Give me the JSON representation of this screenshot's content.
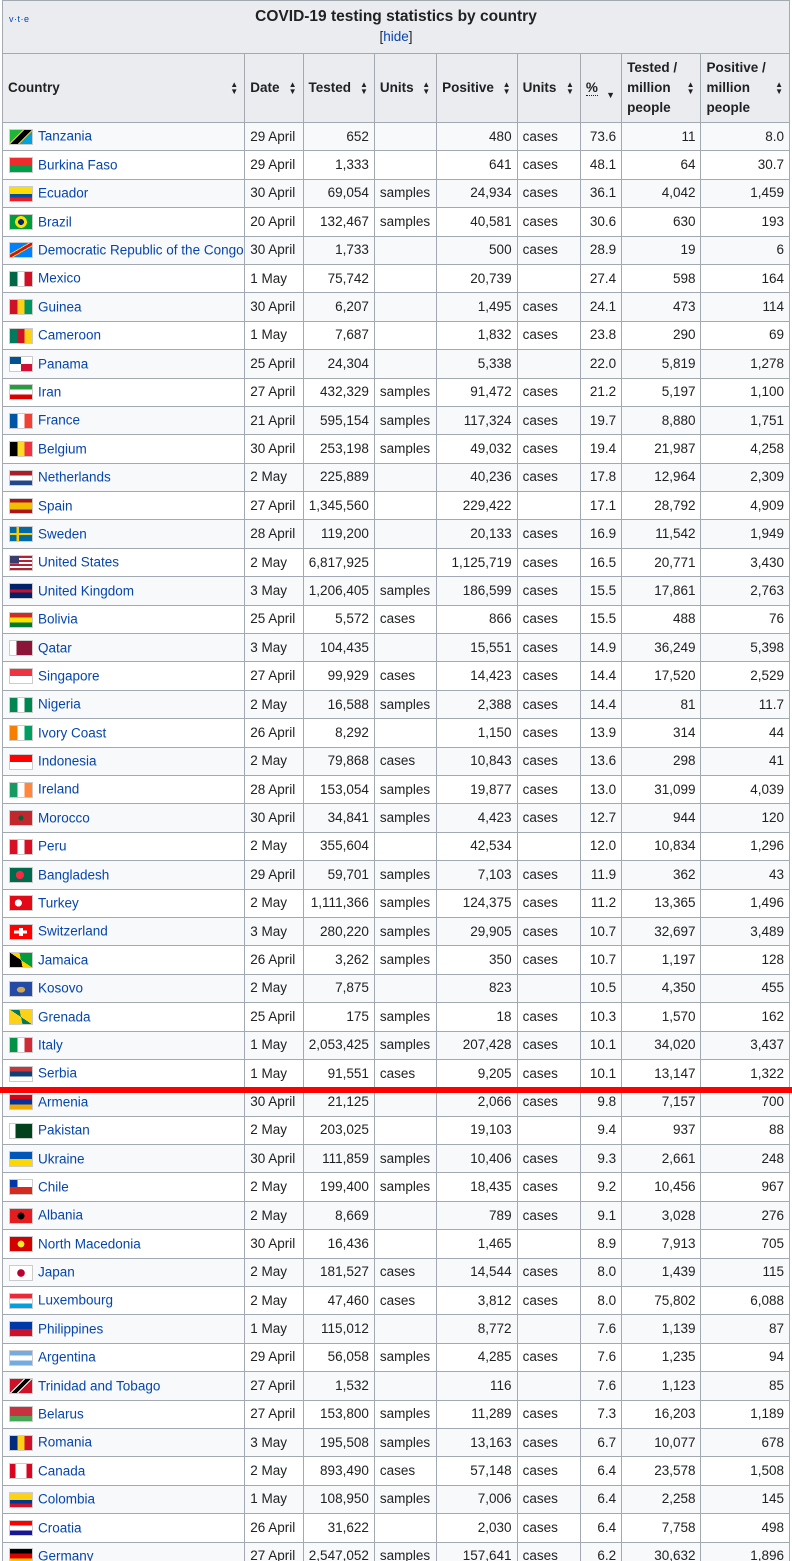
{
  "table": {
    "vte_label": "v·t·e",
    "title": "COVID-19 testing statistics by country",
    "hide_label": "hide",
    "headers": {
      "country": "Country",
      "date": "Date",
      "tested": "Tested",
      "units1": "Units",
      "positive": "Positive",
      "units2": "Units",
      "percent": "%",
      "tested_per_million": "Tested / million people",
      "positive_per_million": "Positive / million people"
    },
    "rows": [
      {
        "country": "Tanzania",
        "date": "29 April",
        "tested": "652",
        "units1": "",
        "positive": "480",
        "units2": "cases",
        "percent": "73.6",
        "tpm": "11",
        "ppm": "8.0",
        "flag": "linear-gradient(135deg,#1eb53a 0 35%,#fcd116 35% 40%,#000 40% 60%,#fcd116 60% 65%,#00a3dd 65%)"
      },
      {
        "country": "Burkina Faso",
        "date": "29 April",
        "tested": "1,333",
        "units1": "",
        "positive": "641",
        "units2": "cases",
        "percent": "48.1",
        "tpm": "64",
        "ppm": "30.7",
        "flag": "linear-gradient(#ef2b2d 50%,#009e49 50%)"
      },
      {
        "country": "Ecuador",
        "date": "30 April",
        "tested": "69,054",
        "units1": "samples",
        "positive": "24,934",
        "units2": "cases",
        "percent": "36.1",
        "tpm": "4,042",
        "ppm": "1,459",
        "flag": "linear-gradient(#ffdd00 50%,#034ea2 50% 75%,#ed1c24 75%)"
      },
      {
        "country": "Brazil",
        "date": "20 April",
        "tested": "132,467",
        "units1": "samples",
        "positive": "40,581",
        "units2": "cases",
        "percent": "30.6",
        "tpm": "630",
        "ppm": "193",
        "flag": "radial-gradient(circle at 50% 50%,#002776 0 22%,#fedf00 23% 45%,#009c3b 46%)"
      },
      {
        "country": "Democratic Republic of the Congo",
        "date": "30 April",
        "tested": "1,733",
        "units1": "",
        "positive": "500",
        "units2": "cases",
        "percent": "28.9",
        "tpm": "19",
        "ppm": "6",
        "flag": "linear-gradient(150deg,#007fff 0 40%,#f7d618 40% 44%,#ce1021 44% 56%,#f7d618 56% 60%,#007fff 60%)"
      },
      {
        "country": "Mexico",
        "date": "1 May",
        "tested": "75,742",
        "units1": "",
        "positive": "20,739",
        "units2": "",
        "percent": "27.4",
        "tpm": "598",
        "ppm": "164",
        "flag": "linear-gradient(90deg,#006847 33%,#fff 33% 67%,#ce1126 67%)"
      },
      {
        "country": "Guinea",
        "date": "30 April",
        "tested": "6,207",
        "units1": "",
        "positive": "1,495",
        "units2": "cases",
        "percent": "24.1",
        "tpm": "473",
        "ppm": "114",
        "flag": "linear-gradient(90deg,#ce1126 33%,#fcd116 33% 67%,#009460 67%)"
      },
      {
        "country": "Cameroon",
        "date": "1 May",
        "tested": "7,687",
        "units1": "",
        "positive": "1,832",
        "units2": "cases",
        "percent": "23.8",
        "tpm": "290",
        "ppm": "69",
        "flag": "linear-gradient(90deg,#007a5e 33%,#ce1126 33% 67%,#fcd116 67%)"
      },
      {
        "country": "Panama",
        "date": "25 April",
        "tested": "24,304",
        "units1": "",
        "positive": "5,338",
        "units2": "",
        "percent": "22.0",
        "tpm": "5,819",
        "ppm": "1,278",
        "flag": "conic-gradient(from 90deg at 50% 50%,#d21034 0 25%,#fff 25% 50%,#005293 50% 75%,#fff 75%)"
      },
      {
        "country": "Iran",
        "date": "27 April",
        "tested": "432,329",
        "units1": "samples",
        "positive": "91,472",
        "units2": "cases",
        "percent": "21.2",
        "tpm": "5,197",
        "ppm": "1,100",
        "flag": "linear-gradient(#239f40 33%,#fff 33% 67%,#da0000 67%)"
      },
      {
        "country": "France",
        "date": "21 April",
        "tested": "595,154",
        "units1": "samples",
        "positive": "117,324",
        "units2": "cases",
        "percent": "19.7",
        "tpm": "8,880",
        "ppm": "1,751",
        "flag": "linear-gradient(90deg,#0055a4 33%,#fff 33% 67%,#ef4135 67%)"
      },
      {
        "country": "Belgium",
        "date": "30 April",
        "tested": "253,198",
        "units1": "samples",
        "positive": "49,032",
        "units2": "cases",
        "percent": "19.4",
        "tpm": "21,987",
        "ppm": "4,258",
        "flag": "linear-gradient(90deg,#000 33%,#fdda24 33% 67%,#ef3340 67%)"
      },
      {
        "country": "Netherlands",
        "date": "2 May",
        "tested": "225,889",
        "units1": "",
        "positive": "40,236",
        "units2": "cases",
        "percent": "17.8",
        "tpm": "12,964",
        "ppm": "2,309",
        "flag": "linear-gradient(#ae1c28 33%,#fff 33% 67%,#21468b 67%)"
      },
      {
        "country": "Spain",
        "date": "27 April",
        "tested": "1,345,560",
        "units1": "",
        "positive": "229,422",
        "units2": "",
        "percent": "17.1",
        "tpm": "28,792",
        "ppm": "4,909",
        "flag": "linear-gradient(#aa151b 25%,#f1bf00 25% 75%,#aa151b 75%)"
      },
      {
        "country": "Sweden",
        "date": "28 April",
        "tested": "119,200",
        "units1": "",
        "positive": "20,133",
        "units2": "cases",
        "percent": "16.9",
        "tpm": "11,542",
        "ppm": "1,949",
        "flag": "linear-gradient(90deg,transparent 30%,#fecc00 30% 42%,transparent 42%),linear-gradient(#006aa7 42%,#fecc00 42% 58%,#006aa7 58%)"
      },
      {
        "country": "United States",
        "date": "2 May",
        "tested": "6,817,925",
        "units1": "",
        "positive": "1,125,719",
        "units2": "cases",
        "percent": "16.5",
        "tpm": "20,771",
        "ppm": "3,430",
        "flag": "linear-gradient(90deg,#3c3b6e 40%,transparent 40%) top/100% 55% no-repeat,repeating-linear-gradient(#b22234 0 2px,#fff 2px 4px)"
      },
      {
        "country": "United Kingdom",
        "date": "3 May",
        "tested": "1,206,405",
        "units1": "samples",
        "positive": "186,599",
        "units2": "cases",
        "percent": "15.5",
        "tpm": "17,861",
        "ppm": "2,763",
        "flag": "linear-gradient(#012169 40%,#c8102e 40% 60%,#012169 60%)"
      },
      {
        "country": "Bolivia",
        "date": "25 April",
        "tested": "5,572",
        "units1": "cases",
        "positive": "866",
        "units2": "cases",
        "percent": "15.5",
        "tpm": "488",
        "ppm": "76",
        "flag": "linear-gradient(#d52b1e 33%,#f9e300 33% 67%,#007934 67%)"
      },
      {
        "country": "Qatar",
        "date": "3 May",
        "tested": "104,435",
        "units1": "",
        "positive": "15,551",
        "units2": "cases",
        "percent": "14.9",
        "tpm": "36,249",
        "ppm": "5,398",
        "flag": "linear-gradient(90deg,#fff 30%,#8a1538 30%)"
      },
      {
        "country": "Singapore",
        "date": "27 April",
        "tested": "99,929",
        "units1": "cases",
        "positive": "14,423",
        "units2": "cases",
        "percent": "14.4",
        "tpm": "17,520",
        "ppm": "2,529",
        "flag": "linear-gradient(#ef3340 50%,#fff 50%)"
      },
      {
        "country": "Nigeria",
        "date": "2 May",
        "tested": "16,588",
        "units1": "samples",
        "positive": "2,388",
        "units2": "cases",
        "percent": "14.4",
        "tpm": "81",
        "ppm": "11.7",
        "flag": "linear-gradient(90deg,#008751 33%,#fff 33% 67%,#008751 67%)"
      },
      {
        "country": "Ivory Coast",
        "date": "26 April",
        "tested": "8,292",
        "units1": "",
        "positive": "1,150",
        "units2": "cases",
        "percent": "13.9",
        "tpm": "314",
        "ppm": "44",
        "flag": "linear-gradient(90deg,#f77f00 33%,#fff 33% 67%,#009e60 67%)"
      },
      {
        "country": "Indonesia",
        "date": "2 May",
        "tested": "79,868",
        "units1": "cases",
        "positive": "10,843",
        "units2": "cases",
        "percent": "13.6",
        "tpm": "298",
        "ppm": "41",
        "flag": "linear-gradient(#ff0000 50%,#fff 50%)"
      },
      {
        "country": "Ireland",
        "date": "28 April",
        "tested": "153,054",
        "units1": "samples",
        "positive": "19,877",
        "units2": "cases",
        "percent": "13.0",
        "tpm": "31,099",
        "ppm": "4,039",
        "flag": "linear-gradient(90deg,#169b62 33%,#fff 33% 67%,#ff883e 67%)"
      },
      {
        "country": "Morocco",
        "date": "30 April",
        "tested": "34,841",
        "units1": "samples",
        "positive": "4,423",
        "units2": "cases",
        "percent": "12.7",
        "tpm": "944",
        "ppm": "120",
        "flag": "radial-gradient(circle,#006233 0 18%,#c1272d 20%)"
      },
      {
        "country": "Peru",
        "date": "2 May",
        "tested": "355,604",
        "units1": "",
        "positive": "42,534",
        "units2": "",
        "percent": "12.0",
        "tpm": "10,834",
        "ppm": "1,296",
        "flag": "linear-gradient(90deg,#d91023 33%,#fff 33% 67%,#d91023 67%)"
      },
      {
        "country": "Bangladesh",
        "date": "29 April",
        "tested": "59,701",
        "units1": "samples",
        "positive": "7,103",
        "units2": "cases",
        "percent": "11.9",
        "tpm": "362",
        "ppm": "43",
        "flag": "radial-gradient(circle at 45% 50%,#f42a41 0 28%,#006a4e 30%)"
      },
      {
        "country": "Turkey",
        "date": "2 May",
        "tested": "1,111,366",
        "units1": "samples",
        "positive": "124,375",
        "units2": "cases",
        "percent": "11.2",
        "tpm": "13,365",
        "ppm": "1,496",
        "flag": "radial-gradient(circle at 38% 50%,#fff 0 22%,#e30a17 24%)"
      },
      {
        "country": "Switzerland",
        "date": "3 May",
        "tested": "280,220",
        "units1": "samples",
        "positive": "29,905",
        "units2": "cases",
        "percent": "10.7",
        "tpm": "32,697",
        "ppm": "3,489",
        "flag": "linear-gradient(90deg,transparent 42%,#fff 42% 58%,transparent 58%) center/100% 60% no-repeat,linear-gradient(transparent 40%,#fff 40% 60%,transparent 60%) center/60% 100% no-repeat,#ff0000"
      },
      {
        "country": "Jamaica",
        "date": "26 April",
        "tested": "3,262",
        "units1": "samples",
        "positive": "350",
        "units2": "cases",
        "percent": "10.7",
        "tpm": "1,197",
        "ppm": "128",
        "flag": "conic-gradient(from 56deg at 50% 50%,#009b3a 0 68deg,#fed100 68deg 112deg,#000 112deg 248deg,#fed100 248deg 292deg,#009b3a 292deg)"
      },
      {
        "country": "Kosovo",
        "date": "2 May",
        "tested": "7,875",
        "units1": "",
        "positive": "823",
        "units2": "",
        "percent": "10.5",
        "tpm": "4,350",
        "ppm": "455",
        "flag": "radial-gradient(ellipse at 50% 55%,#d0a650 0 25%,#244aa5 28%)"
      },
      {
        "country": "Grenada",
        "date": "25 April",
        "tested": "175",
        "units1": "samples",
        "positive": "18",
        "units2": "cases",
        "percent": "10.3",
        "tpm": "1,570",
        "ppm": "162",
        "flag": "conic-gradient(from 56deg at 50% 50%,#fcd116 0 68deg,#007a5e 68deg 112deg,#fcd116 112deg 248deg,#007a5e 248deg 292deg,#fcd116 292deg)"
      },
      {
        "country": "Italy",
        "date": "1 May",
        "tested": "2,053,425",
        "units1": "samples",
        "positive": "207,428",
        "units2": "cases",
        "percent": "10.1",
        "tpm": "34,020",
        "ppm": "3,437",
        "flag": "linear-gradient(90deg,#009246 33%,#fff 33% 67%,#ce2b37 67%)"
      },
      {
        "country": "Serbia",
        "date": "1 May",
        "tested": "91,551",
        "units1": "cases",
        "positive": "9,205",
        "units2": "cases",
        "percent": "10.1",
        "tpm": "13,147",
        "ppm": "1,322",
        "flag": "linear-gradient(#c6363c 33%,#0c4076 33% 67%,#fff 67%)"
      },
      {
        "country": "Armenia",
        "date": "30 April",
        "tested": "21,125",
        "units1": "",
        "positive": "2,066",
        "units2": "cases",
        "percent": "9.8",
        "tpm": "7,157",
        "ppm": "700",
        "flag": "linear-gradient(#d90012 33%,#0033a0 33% 67%,#f2a800 67%)"
      },
      {
        "country": "Pakistan",
        "date": "2 May",
        "tested": "203,025",
        "units1": "",
        "positive": "19,103",
        "units2": "",
        "percent": "9.4",
        "tpm": "937",
        "ppm": "88",
        "flag": "linear-gradient(90deg,#fff 25%,#01411c 25%)"
      },
      {
        "country": "Ukraine",
        "date": "30 April",
        "tested": "111,859",
        "units1": "samples",
        "positive": "10,406",
        "units2": "cases",
        "percent": "9.3",
        "tpm": "2,661",
        "ppm": "248",
        "flag": "linear-gradient(#0057b7 50%,#ffd700 50%)"
      },
      {
        "country": "Chile",
        "date": "2 May",
        "tested": "199,400",
        "units1": "samples",
        "positive": "18,435",
        "units2": "cases",
        "percent": "9.2",
        "tpm": "10,456",
        "ppm": "967",
        "flag": "linear-gradient(90deg,#0039a6 35%,transparent 35%) top/100% 50% no-repeat,linear-gradient(#fff 50%,#d52b1e 50%)"
      },
      {
        "country": "Albania",
        "date": "2 May",
        "tested": "8,669",
        "units1": "",
        "positive": "789",
        "units2": "cases",
        "percent": "9.1",
        "tpm": "3,028",
        "ppm": "276",
        "flag": "radial-gradient(circle,#000 0 25%,#e41e20 28%)"
      },
      {
        "country": "North Macedonia",
        "date": "30 April",
        "tested": "16,436",
        "units1": "",
        "positive": "1,465",
        "units2": "",
        "percent": "8.9",
        "tpm": "7,913",
        "ppm": "705",
        "flag": "radial-gradient(circle,#f8e92e 0 25%,#d20000 26%)"
      },
      {
        "country": "Japan",
        "date": "2 May",
        "tested": "181,527",
        "units1": "cases",
        "positive": "14,544",
        "units2": "cases",
        "percent": "8.0",
        "tpm": "1,439",
        "ppm": "115",
        "flag": "radial-gradient(circle,#bc002d 0 28%,#fff 30%)"
      },
      {
        "country": "Luxembourg",
        "date": "2 May",
        "tested": "47,460",
        "units1": "cases",
        "positive": "3,812",
        "units2": "cases",
        "percent": "8.0",
        "tpm": "75,802",
        "ppm": "6,088",
        "flag": "linear-gradient(#ed2939 33%,#fff 33% 67%,#00a1de 67%)"
      },
      {
        "country": "Philippines",
        "date": "1 May",
        "tested": "115,012",
        "units1": "",
        "positive": "8,772",
        "units2": "",
        "percent": "7.6",
        "tpm": "1,139",
        "ppm": "87",
        "flag": "linear-gradient(#0038a8 50%,#ce1126 50%)"
      },
      {
        "country": "Argentina",
        "date": "29 April",
        "tested": "56,058",
        "units1": "samples",
        "positive": "4,285",
        "units2": "cases",
        "percent": "7.6",
        "tpm": "1,235",
        "ppm": "94",
        "flag": "linear-gradient(#74acdf 33%,#fff 33% 67%,#74acdf 67%)"
      },
      {
        "country": "Trinidad and Tobago",
        "date": "27 April",
        "tested": "1,532",
        "units1": "",
        "positive": "116",
        "units2": "",
        "percent": "7.6",
        "tpm": "1,123",
        "ppm": "85",
        "flag": "linear-gradient(135deg,#ce1126 0 38%,#fff 38% 42%,#000 42% 58%,#fff 58% 62%,#ce1126 62%)"
      },
      {
        "country": "Belarus",
        "date": "27 April",
        "tested": "153,800",
        "units1": "samples",
        "positive": "11,289",
        "units2": "cases",
        "percent": "7.3",
        "tpm": "16,203",
        "ppm": "1,189",
        "flag": "linear-gradient(#c8313e 66%,#4aa657 66%)"
      },
      {
        "country": "Romania",
        "date": "3 May",
        "tested": "195,508",
        "units1": "samples",
        "positive": "13,163",
        "units2": "cases",
        "percent": "6.7",
        "tpm": "10,077",
        "ppm": "678",
        "flag": "linear-gradient(90deg,#002b7f 33%,#fcd116 33% 67%,#ce1126 67%)"
      },
      {
        "country": "Canada",
        "date": "2 May",
        "tested": "893,490",
        "units1": "cases",
        "positive": "57,148",
        "units2": "cases",
        "percent": "6.4",
        "tpm": "23,578",
        "ppm": "1,508",
        "flag": "linear-gradient(90deg,#d80621 25%,#fff 25% 75%,#d80621 75%)"
      },
      {
        "country": "Colombia",
        "date": "1 May",
        "tested": "108,950",
        "units1": "samples",
        "positive": "7,006",
        "units2": "cases",
        "percent": "6.4",
        "tpm": "2,258",
        "ppm": "145",
        "flag": "linear-gradient(#fcd116 50%,#003893 50% 75%,#ce1126 75%)"
      },
      {
        "country": "Croatia",
        "date": "26 April",
        "tested": "31,622",
        "units1": "",
        "positive": "2,030",
        "units2": "cases",
        "percent": "6.4",
        "tpm": "7,758",
        "ppm": "498",
        "flag": "linear-gradient(#ff0000 33%,#fff 33% 67%,#171796 67%)"
      },
      {
        "country": "Germany",
        "date": "27 April",
        "tested": "2,547,052",
        "units1": "samples",
        "positive": "157,641",
        "units2": "cases",
        "percent": "6.2",
        "tpm": "30,632",
        "ppm": "1,896",
        "flag": "linear-gradient(#000 33%,#dd0000 33% 67%,#ffce00 67%)"
      }
    ]
  }
}
